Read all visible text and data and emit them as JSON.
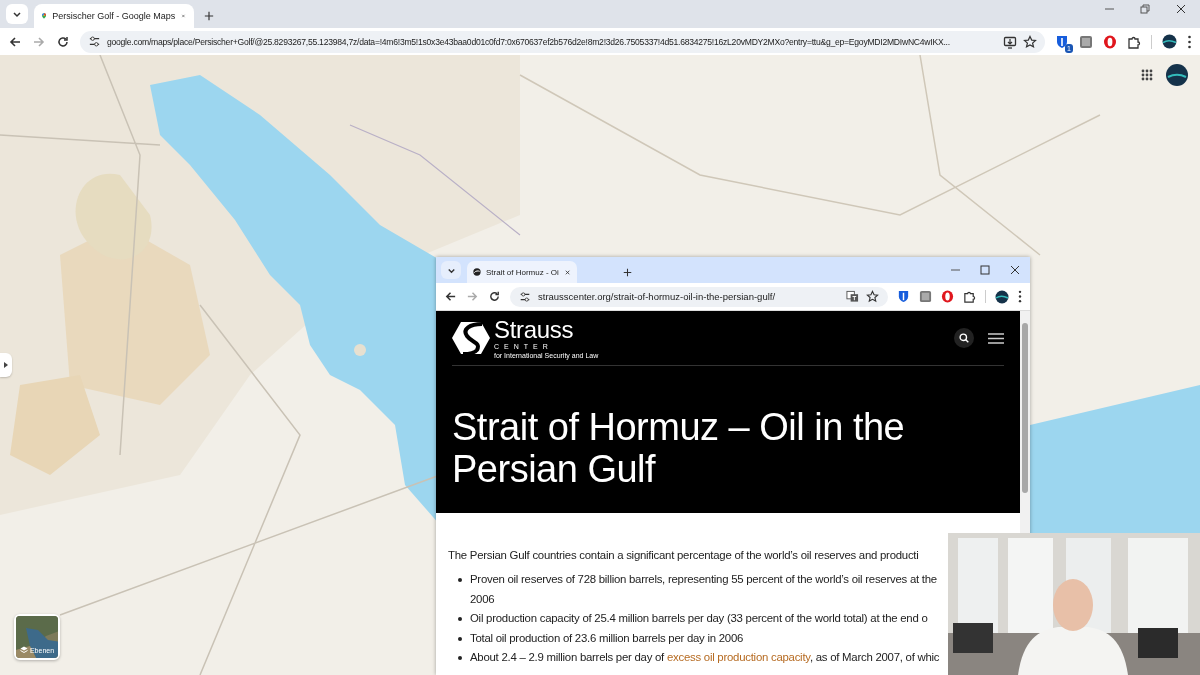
{
  "browser": {
    "tabs": [
      {
        "title": "Persischer Golf - Google Maps",
        "selected": true
      }
    ],
    "url": "google.com/maps/place/Persischer+Golf/@25.8293267,55.123984,7z/data=!4m6!3m5!1s0x3e43baa0d01c0fd7:0x670637ef2b576d2e!8m2!3d26.7505337!4d51.6834275!16zL20vMDY2MXo?entry=ttu&g_ep=EgoyMDI2MDIwNC4wIKX...",
    "extension_badge": "1"
  },
  "map": {
    "kind": "picture",
    "layers_button": "Ebenen"
  },
  "popup_window": {
    "tabs": [
      {
        "title": "Strait of Hormuz - Oi",
        "selected": true
      }
    ],
    "url": "strausscenter.org/strait-of-hormuz-oil-in-the-persian-gulf/",
    "logo": {
      "name": "Strauss",
      "sub": "CENTER",
      "tagline": "for International Security and Law"
    },
    "title": "Strait of Hormuz – Oil in the Persian Gulf",
    "intro": "The Persian Gulf countries contain a significant percentage of the world’s oil reserves and producti",
    "bullets": [
      {
        "lines": [
          "Proven oil reserves of 728 billion barrels, representing 55 percent of the world’s oil reserves at the",
          "2006"
        ]
      },
      {
        "lines": [
          "Oil production capacity of 25.4 million barrels per day (33 percent of the world total) at the end o"
        ]
      },
      {
        "lines": [
          "Total oil production of 23.6 million barrels per day in 2006"
        ]
      },
      {
        "lines": [
          "About 2.4 – 2.9 million barrels per day of "
        ],
        "link": "excess oil production capacity",
        "after": ", as of March 2007, of whic"
      }
    ]
  }
}
